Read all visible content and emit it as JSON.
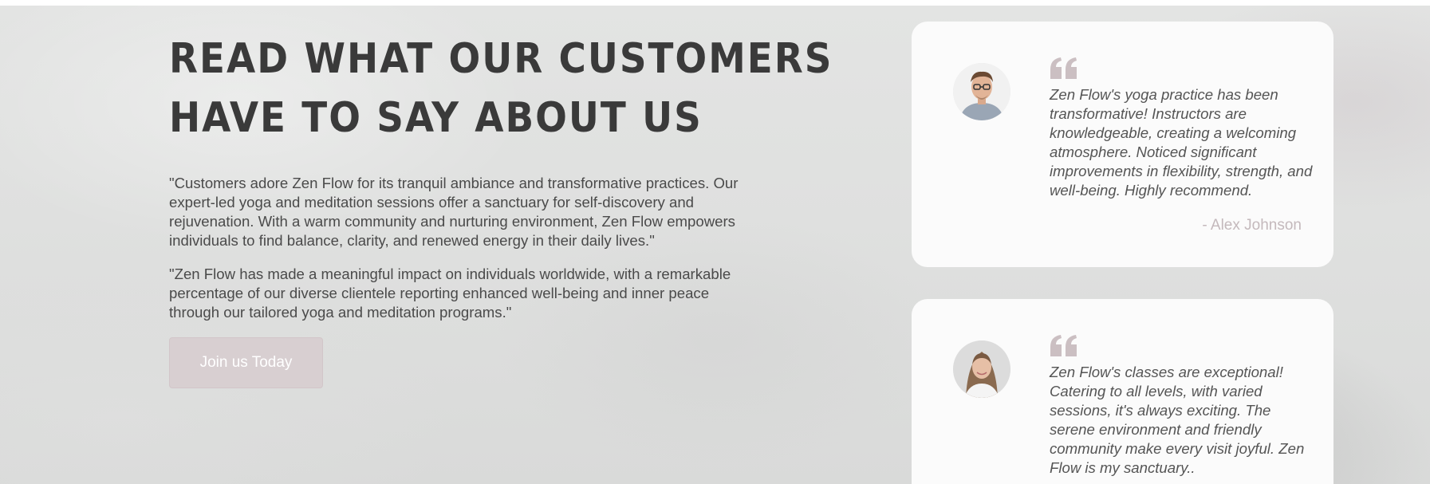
{
  "section": {
    "heading_line_1": "READ WHAT OUR CUSTOMERS",
    "heading_line_2": "HAVE TO SAY ABOUT US",
    "paragraph_1": "\"Customers adore Zen Flow for its tranquil ambiance and transformative practices. Our expert-led yoga and meditation sessions offer a sanctuary for self-discovery and rejuvenation. With a warm community and nurturing environment, Zen Flow empowers individuals to find balance, clarity, and renewed energy in their daily lives.\"",
    "paragraph_2": "\"Zen Flow has made a meaningful impact on individuals worldwide, with a remarkable percentage of our diverse clientele reporting enhanced well-being and inner peace through our tailored yoga and meditation programs.\"",
    "cta_label": "Join us Today"
  },
  "testimonials": [
    {
      "text": "Zen Flow's yoga practice has been transformative! Instructors are knowledgeable, creating a welcoming atmosphere. Noticed significant improvements in flexibility, strength, and well-being. Highly recommend.",
      "author": "- Alex Johnson",
      "avatar_icon": "male-avatar"
    },
    {
      "text": "Zen Flow's classes are exceptional! Catering to all levels, with varied sessions, it's always exciting. The serene environment and friendly community make every visit joyful. Zen Flow is my sanctuary..",
      "author": "",
      "avatar_icon": "female-avatar"
    }
  ],
  "colors": {
    "heading": "#3a3a3a",
    "body_text": "#4a4a4a",
    "button_bg": "#d8cfd1",
    "card_bg": "#fbfbfb",
    "quote_icon": "#cbbfc2",
    "author": "#c4b9bc"
  },
  "icons": {
    "quote": "quote-icon"
  }
}
